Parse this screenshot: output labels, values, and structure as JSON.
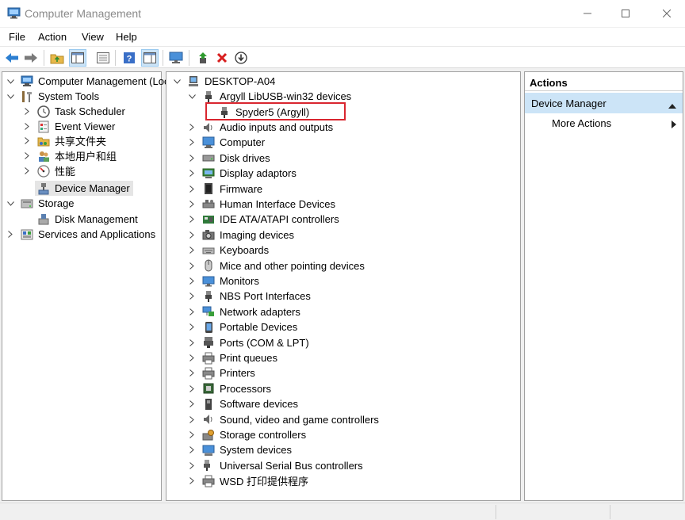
{
  "window": {
    "title": "Computer Management",
    "icon": "computer-management-icon"
  },
  "menu": [
    {
      "label": "File"
    },
    {
      "label": "Action"
    },
    {
      "label": "View"
    },
    {
      "label": "Help"
    }
  ],
  "toolbar": {
    "buttons": [
      "back-arrow-icon",
      "forward-arrow-icon",
      "up-folder-icon",
      "show-hide-tree-icon",
      "properties-icon",
      "help-icon",
      "action-pane-icon",
      "monitor-icon",
      "update-driver-icon",
      "uninstall-icon",
      "scan-download-icon"
    ]
  },
  "left_tree": {
    "items": [
      {
        "label": "Computer Management (Local)",
        "icon": "computer-management-icon",
        "chevron": "down"
      },
      {
        "label": "System Tools",
        "icon": "tools-icon",
        "chevron": "down"
      },
      {
        "label": "Task Scheduler",
        "icon": "clock-icon",
        "chevron": "right"
      },
      {
        "label": "Event Viewer",
        "icon": "event-viewer-icon",
        "chevron": "right"
      },
      {
        "label": "共享文件夹",
        "icon": "shared-folder-icon",
        "chevron": "right"
      },
      {
        "label": "本地用户和组",
        "icon": "users-icon",
        "chevron": "right"
      },
      {
        "label": "性能",
        "icon": "performance-icon",
        "chevron": "right"
      },
      {
        "label": "Device Manager",
        "icon": "device-manager-icon",
        "chevron": "",
        "selected": true
      },
      {
        "label": "Storage",
        "icon": "storage-icon",
        "chevron": "down"
      },
      {
        "label": "Disk Management",
        "icon": "disk-management-icon",
        "chevron": ""
      },
      {
        "label": "Services and Applications",
        "icon": "services-icon",
        "chevron": "right"
      }
    ]
  },
  "device_tree": {
    "root": "DESKTOP-A04",
    "expanded_category": "Argyll LibUSB-win32 devices",
    "expanded_child": "Spyder5 (Argyll)",
    "categories": [
      {
        "label": "Audio inputs and outputs",
        "icon": "speaker-icon"
      },
      {
        "label": "Computer",
        "icon": "computer-icon"
      },
      {
        "label": "Disk drives",
        "icon": "disk-drive-icon"
      },
      {
        "label": "Display adaptors",
        "icon": "display-adapter-icon"
      },
      {
        "label": "Firmware",
        "icon": "firmware-icon"
      },
      {
        "label": "Human Interface Devices",
        "icon": "hid-icon"
      },
      {
        "label": "IDE ATA/ATAPI controllers",
        "icon": "ide-controller-icon"
      },
      {
        "label": "Imaging devices",
        "icon": "camera-icon"
      },
      {
        "label": "Keyboards",
        "icon": "keyboard-icon"
      },
      {
        "label": "Mice and other pointing devices",
        "icon": "mouse-icon"
      },
      {
        "label": "Monitors",
        "icon": "monitor-icon"
      },
      {
        "label": "NBS Port Interfaces",
        "icon": "usb-plug-icon"
      },
      {
        "label": "Network adapters",
        "icon": "network-icon"
      },
      {
        "label": "Portable Devices",
        "icon": "portable-device-icon"
      },
      {
        "label": "Ports (COM & LPT)",
        "icon": "port-icon"
      },
      {
        "label": "Print queues",
        "icon": "printer-icon"
      },
      {
        "label": "Printers",
        "icon": "printer-icon"
      },
      {
        "label": "Processors",
        "icon": "processor-icon"
      },
      {
        "label": "Software devices",
        "icon": "software-device-icon"
      },
      {
        "label": "Sound, video and game controllers",
        "icon": "speaker-icon"
      },
      {
        "label": "Storage controllers",
        "icon": "storage-controller-icon"
      },
      {
        "label": "System devices",
        "icon": "system-device-icon"
      },
      {
        "label": "Universal Serial Bus controllers",
        "icon": "usb-icon"
      },
      {
        "label": "WSD 打印提供程序",
        "icon": "printer-icon"
      }
    ]
  },
  "actions": {
    "header": "Actions",
    "section": "Device Manager",
    "more": "More Actions"
  },
  "colors": {
    "highlight_box": "#d9262f",
    "actions_band": "#cce4f7",
    "selection": "#e5e5e5"
  }
}
